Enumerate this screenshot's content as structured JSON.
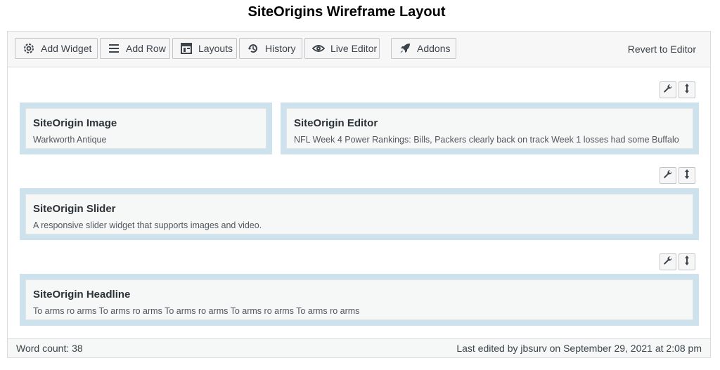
{
  "page": {
    "title": "SiteOrigins Wireframe Layout"
  },
  "toolbar": {
    "buttons": [
      {
        "label": "Add Widget",
        "icon": "gear-icon"
      },
      {
        "label": "Add Row",
        "icon": "rows-icon"
      },
      {
        "label": "Layouts",
        "icon": "layout-icon"
      },
      {
        "label": "History",
        "icon": "history-icon"
      },
      {
        "label": "Live Editor",
        "icon": "eye-icon"
      },
      {
        "label": "Addons",
        "icon": "rocket-icon"
      }
    ],
    "revert_label": "Revert to Editor"
  },
  "rows": [
    {
      "widgets": [
        {
          "title": "SiteOrigin Image",
          "description": "Warkworth Antique"
        },
        {
          "title": "SiteOrigin Editor",
          "description": "NFL Week 4 Power Rankings: Bills, Packers clearly back on track Week 1 losses had some Buffalo"
        }
      ]
    },
    {
      "widgets": [
        {
          "title": "SiteOrigin Slider",
          "description": "A responsive slider widget that supports images and video."
        }
      ]
    },
    {
      "widgets": [
        {
          "title": "SiteOrigin Headline",
          "description": "To arms ro arms To arms ro arms To arms ro arms To arms ro arms To arms ro arms"
        }
      ]
    }
  ],
  "status": {
    "word_count": "Word count: 38",
    "last_edited": "Last edited by jbsurv on September 29, 2021 at 2:08 pm"
  },
  "colors": {
    "row_background": "#cde2ec",
    "widget_background": "#f6f7f7",
    "toolbar_background": "#f7f7f7"
  }
}
